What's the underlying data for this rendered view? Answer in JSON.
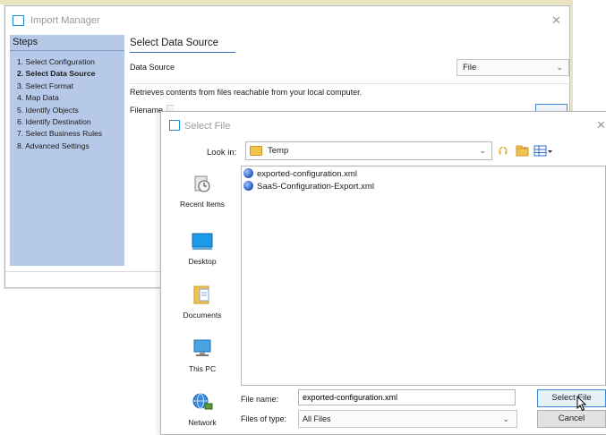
{
  "import_manager": {
    "title": "Import Manager",
    "steps_header": "Steps",
    "steps": [
      "1. Select Configuration",
      "2. Select Data Source",
      "3. Select Format",
      "4. Map Data",
      "5. Identify Objects",
      "6. Identify Destination",
      "7. Select Business Rules",
      "8. Advanced Settings"
    ],
    "active_step_index": 1,
    "heading": "Select Data Source",
    "data_source_label": "Data Source",
    "data_source_value": "File",
    "description": "Retrieves contents from files reachable from your local computer.",
    "filename_label": "Filename"
  },
  "select_file": {
    "title": "Select File",
    "look_in_label": "Look in:",
    "look_in_value": "Temp",
    "places": [
      "Recent Items",
      "Desktop",
      "Documents",
      "This PC",
      "Network"
    ],
    "files": [
      "exported-configuration.xml",
      "SaaS-Configuration-Export.xml"
    ],
    "file_name_label": "File name:",
    "file_name_value": "exported-configuration.xml",
    "files_of_type_label": "Files of type:",
    "files_of_type_value": "All Files",
    "select_button": "Select File",
    "cancel_button": "Cancel"
  },
  "colors": {
    "steps_panel": "#b6c9e8",
    "accent": "#3d8bd8",
    "icon_border": "#1c8cd8"
  },
  "icons": [
    "app-window-icon",
    "close-icon",
    "chevron-down-icon",
    "folder-icon",
    "up-folder-icon",
    "new-folder-icon",
    "view-menu-icon",
    "recent-items-icon",
    "desktop-icon",
    "documents-icon",
    "this-pc-icon",
    "network-icon",
    "xml-file-icon",
    "mouse-cursor-icon"
  ]
}
